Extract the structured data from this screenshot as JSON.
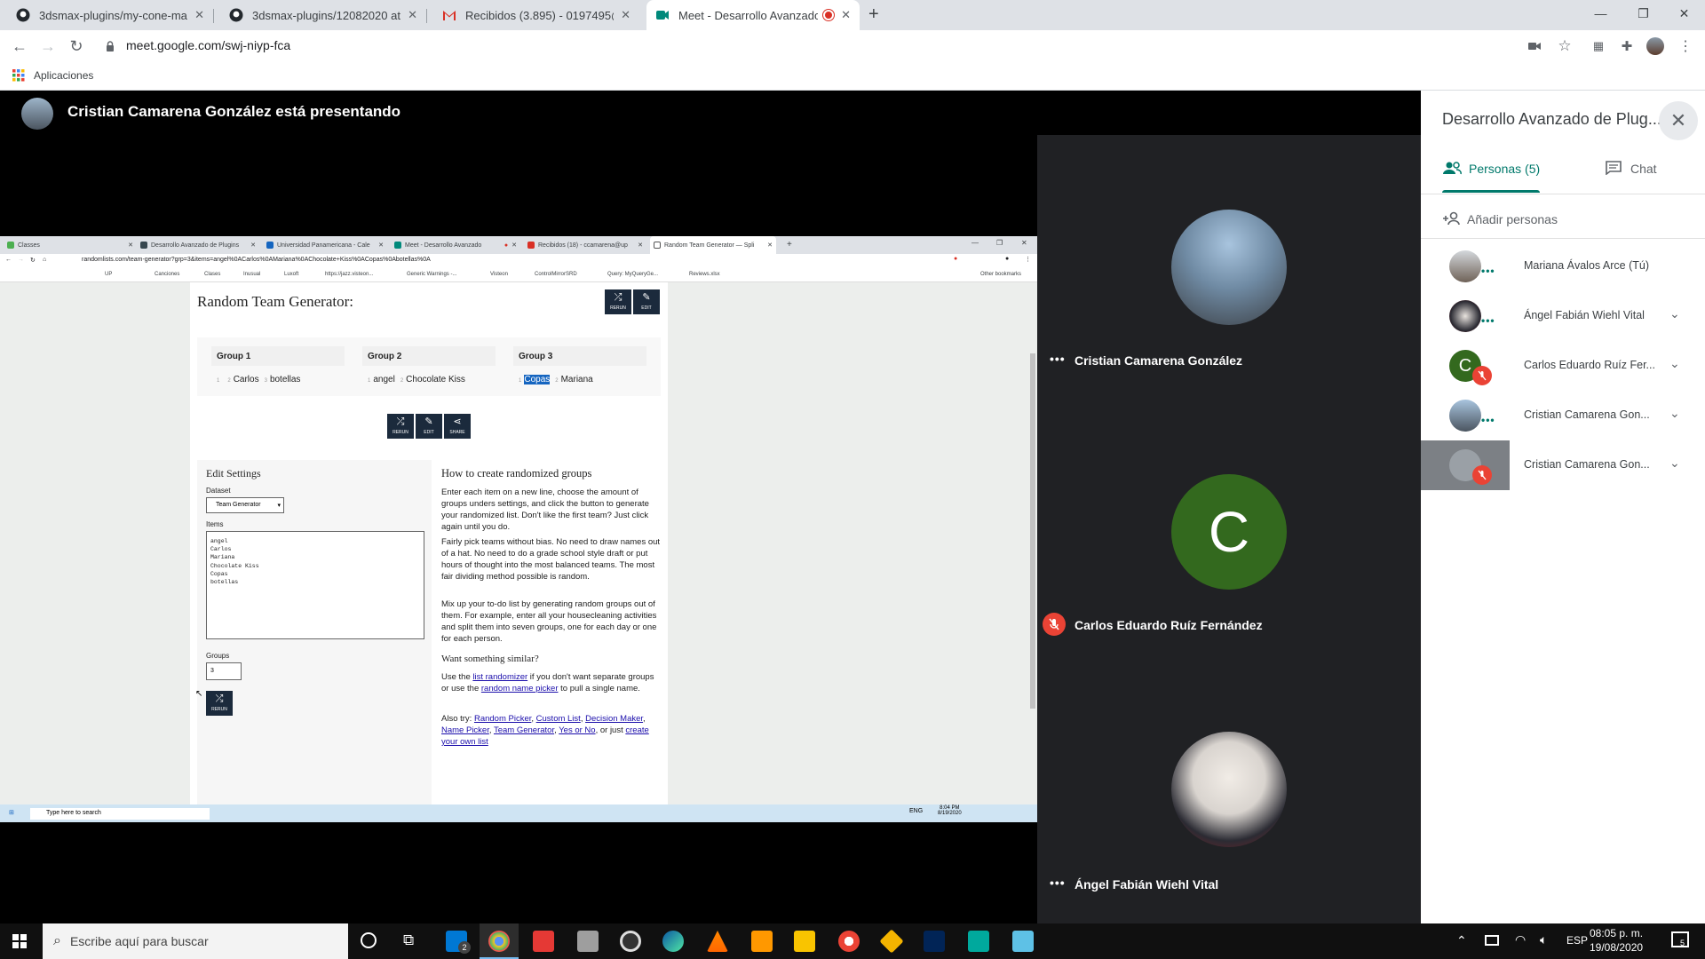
{
  "browser": {
    "tabs": [
      {
        "title": "3dsmax-plugins/my-cone-marian",
        "icon": "github-icon"
      },
      {
        "title": "3dsmax-plugins/12082020 at ma",
        "icon": "github-icon"
      },
      {
        "title": "Recibidos (3.895) - 0197495@up.",
        "icon": "gmail-icon"
      },
      {
        "title": "Meet - Desarrollo Avanzado",
        "icon": "meet-icon"
      }
    ],
    "url": "meet.google.com/swj-niyp-fca",
    "bookmark_apps": "Aplicaciones"
  },
  "meet": {
    "presenter_text": "Cristian Camarena González está presentando",
    "tiles": [
      {
        "name": "Cristian Camarena González",
        "muted": false
      },
      {
        "name": "Carlos Eduardo Ruíz Fernández",
        "muted": true,
        "initial": "C"
      },
      {
        "name": "Ángel Fabián Wiehl Vital",
        "muted": false
      }
    ],
    "panel": {
      "title": "Desarrollo Avanzado de Plug...",
      "tab_people": "Personas (5)",
      "tab_chat": "Chat",
      "add_people": "Añadir personas",
      "participants": [
        {
          "name": "Mariana Ávalos Arce (Tú)",
          "muted": false,
          "speaking": true
        },
        {
          "name": "Ángel Fabián Wiehl Vital",
          "muted": false,
          "speaking": true
        },
        {
          "name": "Carlos Eduardo Ruíz Fer...",
          "muted": true,
          "initial": "C"
        },
        {
          "name": "Cristian Camarena Gon...",
          "muted": false,
          "speaking": true
        },
        {
          "name": "Cristian Camarena Gon...",
          "muted": true
        }
      ]
    }
  },
  "shared_screen": {
    "tabs": [
      "Classes",
      "Desarrollo Avanzado de Plugins",
      "Universidad Panamericana - Cale",
      "Meet - Desarrollo Avanzado",
      "Recibidos (18) - ccamarena@up",
      "Random Team Generator — Spli"
    ],
    "url": "randomlists.com/team-generator?grp=3&items=angel%0ACarlos%0AMariana%0AChocolate+Kiss%0ACopas%0Abotellas%0A",
    "bookmarks": [
      "UP",
      "Canciones",
      "Clases",
      "Inusual",
      "Luxoft",
      "https://jazz.visteon...",
      "Generic Warnings -...",
      "Visteon",
      "ControlMirrorSRD",
      "Query: MyQueryGe...",
      "Reviews.xlsx",
      "Other bookmarks"
    ],
    "page": {
      "title": "Random Team Generator:",
      "rerun": "RERUN",
      "edit": "EDIT",
      "share": "SHARE",
      "groups": [
        {
          "header": "Group 1",
          "items": [
            "",
            "Carlos",
            "botellas"
          ]
        },
        {
          "header": "Group 2",
          "items": [
            "angel",
            "Chocolate Kiss"
          ]
        },
        {
          "header": "Group 3",
          "items": [
            "Copas",
            "Mariana"
          ]
        }
      ],
      "edit_settings": "Edit Settings",
      "dataset_label": "Dataset",
      "dataset_value": "Team Generator",
      "items_label": "Items",
      "items_value": "angel\nCarlos\nMariana\nChocolate Kiss\nCopas\nbotellas",
      "groups_label": "Groups",
      "groups_value": "3",
      "how_title": "How to create randomized groups",
      "how_p1": "Enter each item on a new line, choose the amount of groups unders settings, and click the button to generate your randomized list. Don't like the first team? Just click again until you do.",
      "how_p2": "Fairly pick teams without bias. No need to draw names out of a hat. No need to do a grade school style draft or put hours of thought into the most balanced teams. The most fair dividing method possible is random.",
      "how_p3": "Mix up your to-do list by generating random groups out of them. For example, enter all your housecleaning activities and split them into seven groups, one for each day or one for each person.",
      "similar_title": "Want something similar?",
      "similar_text_1": "Use the ",
      "similar_link_1": "list randomizer",
      "similar_text_2": " if you don't want separate groups or use the ",
      "similar_link_2": "random name picker",
      "similar_text_3": " to pull a single name.",
      "also_try": "Also try:",
      "also_links": [
        "Random Picker",
        "Custom List",
        "Decision Maker",
        "Name Picker",
        "Team Generator",
        "Yes or No"
      ],
      "also_end": ", or just",
      "also_last": "create your own list"
    },
    "taskbar": {
      "search": "Type here to search",
      "time": "8:04 PM",
      "date": "8/19/2020",
      "lang": "ENG"
    }
  },
  "windows": {
    "search_placeholder": "Escribe aquí para buscar",
    "time": "08:05 p. m.",
    "date": "19/08/2020",
    "lang": "ESP",
    "mail_badge": "2",
    "notif_badge": "5"
  },
  "colors": {
    "meet_teal": "#00796b",
    "mute_red": "#ea4335",
    "avatar_green": "#33691e",
    "tile_bg": "#202124"
  }
}
